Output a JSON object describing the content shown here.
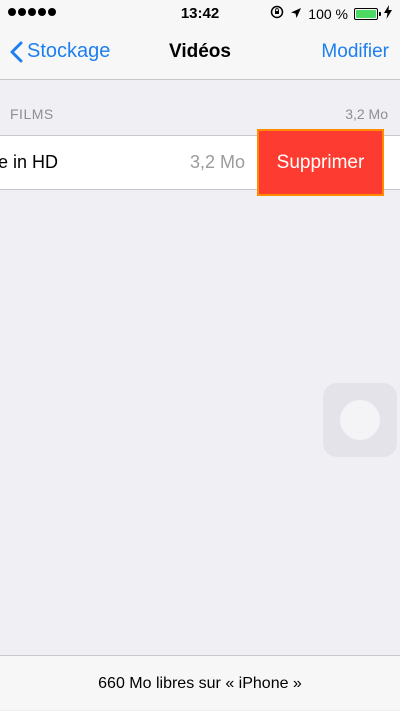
{
  "status_bar": {
    "signal_dots": 5,
    "time": "13:42",
    "battery_text": "100 %",
    "icons": [
      "rotation-lock-icon",
      "location-arrow-icon",
      "battery-icon",
      "charging-bolt-icon"
    ],
    "battery_color": "#4cd964"
  },
  "nav": {
    "back_label": "Stockage",
    "title": "Vidéos",
    "edit_label": "Modifier",
    "accent_color": "#1e7ff0"
  },
  "section": {
    "title": "FILMS",
    "total_size": "3,2 Mo"
  },
  "videos": [
    {
      "name": "e in HD",
      "size": "3,2 Mo"
    }
  ],
  "actions": {
    "delete_label": "Supprimer",
    "delete_color": "#fe3b30"
  },
  "footer": {
    "text": "660 Mo libres sur « iPhone  »"
  }
}
